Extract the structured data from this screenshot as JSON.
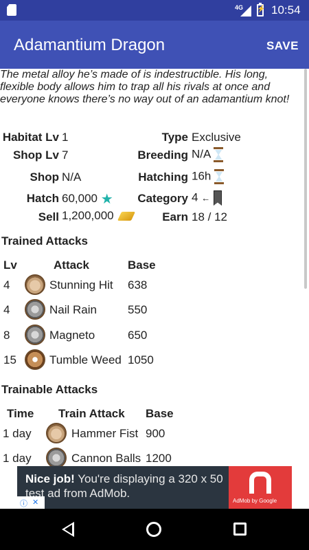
{
  "status": {
    "network": "4G",
    "time": "10:54"
  },
  "appbar": {
    "title": "Adamantium Dragon",
    "save": "SAVE"
  },
  "description": "The metal alloy he’s made of is indestructible. His long, flexible body allows him to trap all his rivals at once and everyone knows there’s no way out of an adamantium knot!",
  "info": {
    "habitat_lv_label": "Habitat Lv",
    "habitat_lv": "1",
    "shop_lv_label": "Shop Lv",
    "shop_lv": "7",
    "shop_label": "Shop",
    "shop": "N/A",
    "hatch_label": "Hatch",
    "hatch": "60,000",
    "sell_label": "Sell",
    "sell": "1,200,000",
    "type_label": "Type",
    "type": "Exclusive",
    "breeding_label": "Breeding",
    "breeding": "N/A",
    "hatching_label": "Hatching",
    "hatching": "16h",
    "category_label": "Category",
    "category": "4",
    "category_arrow": "←",
    "earn_label": "Earn",
    "earn": "18 / 12"
  },
  "trained": {
    "title": "Trained Attacks",
    "headers": {
      "lv": "Lv",
      "attack": "Attack",
      "base": "Base"
    },
    "rows": [
      {
        "lv": "4",
        "icon": "fist-icon",
        "attack": "Stunning Hit",
        "base": "638"
      },
      {
        "lv": "4",
        "icon": "nail-icon",
        "attack": "Nail Rain",
        "base": "550"
      },
      {
        "lv": "8",
        "icon": "nail-icon",
        "attack": "Magneto",
        "base": "650"
      },
      {
        "lv": "15",
        "icon": "hourglass-icon",
        "attack": "Tumble Weed",
        "base": "1050"
      }
    ]
  },
  "trainable": {
    "title": "Trainable Attacks",
    "headers": {
      "time": "Time",
      "attack": "Train Attack",
      "base": "Base"
    },
    "rows": [
      {
        "time": "1 day",
        "icon": "fist-icon",
        "attack": "Hammer Fist",
        "base": "900"
      },
      {
        "time": "1 day",
        "icon": "nail-icon",
        "attack": "Cannon Balls",
        "base": "1200"
      }
    ]
  },
  "ad": {
    "headline": "Nice job!",
    "body": "You're displaying a 320 x 50 test ad from AdMob.",
    "caption": "AdMob by Google"
  },
  "colors": {
    "primary": "#3F51B5",
    "primary_dark": "#303F9F",
    "ad_red": "#E33B3B"
  }
}
